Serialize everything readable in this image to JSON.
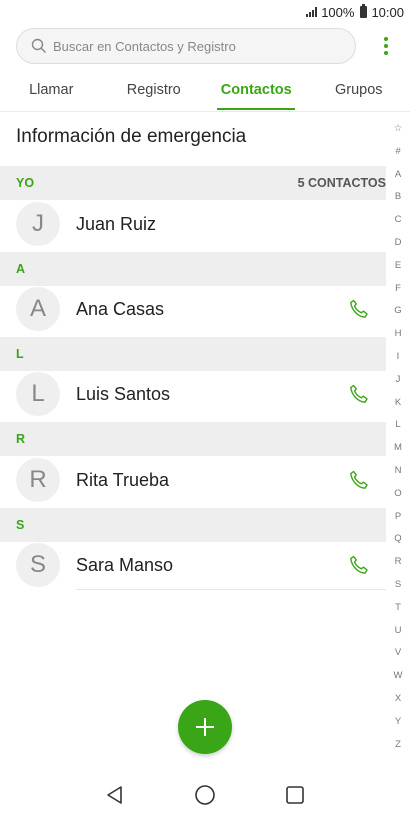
{
  "status_bar": {
    "battery": "100%",
    "time": "10:00"
  },
  "search": {
    "placeholder": "Buscar en Contactos y Registro"
  },
  "tabs": [
    {
      "label": "Llamar",
      "active": false
    },
    {
      "label": "Registro",
      "active": false
    },
    {
      "label": "Contactos",
      "active": true
    },
    {
      "label": "Grupos",
      "active": false
    }
  ],
  "emergency_label": "Información de emergencia",
  "sections": [
    {
      "letter": "YO",
      "count": "5 CONTACTOS",
      "contacts": [
        {
          "initial": "J",
          "name": "Juan Ruiz",
          "call": false
        }
      ]
    },
    {
      "letter": "A",
      "contacts": [
        {
          "initial": "A",
          "name": "Ana Casas",
          "call": true
        }
      ]
    },
    {
      "letter": "L",
      "contacts": [
        {
          "initial": "L",
          "name": "Luis Santos",
          "call": true
        }
      ]
    },
    {
      "letter": "R",
      "contacts": [
        {
          "initial": "R",
          "name": "Rita Trueba",
          "call": true
        }
      ]
    },
    {
      "letter": "S",
      "contacts": [
        {
          "initial": "S",
          "name": "Sara Manso",
          "call": true
        }
      ]
    }
  ],
  "index_letters": [
    "☆",
    "#",
    "A",
    "B",
    "C",
    "D",
    "E",
    "F",
    "G",
    "H",
    "I",
    "J",
    "K",
    "L",
    "M",
    "N",
    "O",
    "P",
    "Q",
    "R",
    "S",
    "T",
    "U",
    "V",
    "W",
    "X",
    "Y",
    "Z"
  ],
  "colors": {
    "accent": "#3aa517",
    "section_bg": "#eeeeee",
    "avatar_bg": "#efefef"
  },
  "icons": {
    "search": "search-icon",
    "more": "more-vert-icon",
    "call": "phone-icon",
    "add": "plus-icon",
    "back": "back-triangle-icon",
    "home": "home-circle-icon",
    "recents": "recents-square-icon"
  }
}
